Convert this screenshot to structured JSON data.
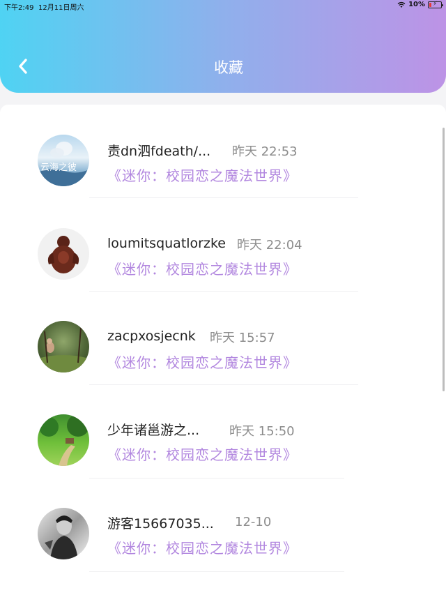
{
  "status_bar": {
    "time": "下午2:49",
    "date": "12月11日周六",
    "battery": "10%"
  },
  "header": {
    "title": "收藏"
  },
  "items": [
    {
      "name": "责dn泗fdeath/...",
      "time": "昨天 22:53",
      "work": "《迷你：校园恋之魔法世界》",
      "avatar_text": "云海之彼"
    },
    {
      "name": "loumitsquatlorzke",
      "time": "昨天 22:04",
      "work": "《迷你：校园恋之魔法世界》"
    },
    {
      "name": "zacpxosjecnk",
      "time": "昨天 15:57",
      "work": "《迷你：校园恋之魔法世界》"
    },
    {
      "name": "少年诸邕游之...",
      "time": "昨天 15:50",
      "work": "《迷你：校园恋之魔法世界》"
    },
    {
      "name": "游客15667035...",
      "time": "12-10",
      "work": "《迷你：校园恋之魔法世界》"
    }
  ]
}
